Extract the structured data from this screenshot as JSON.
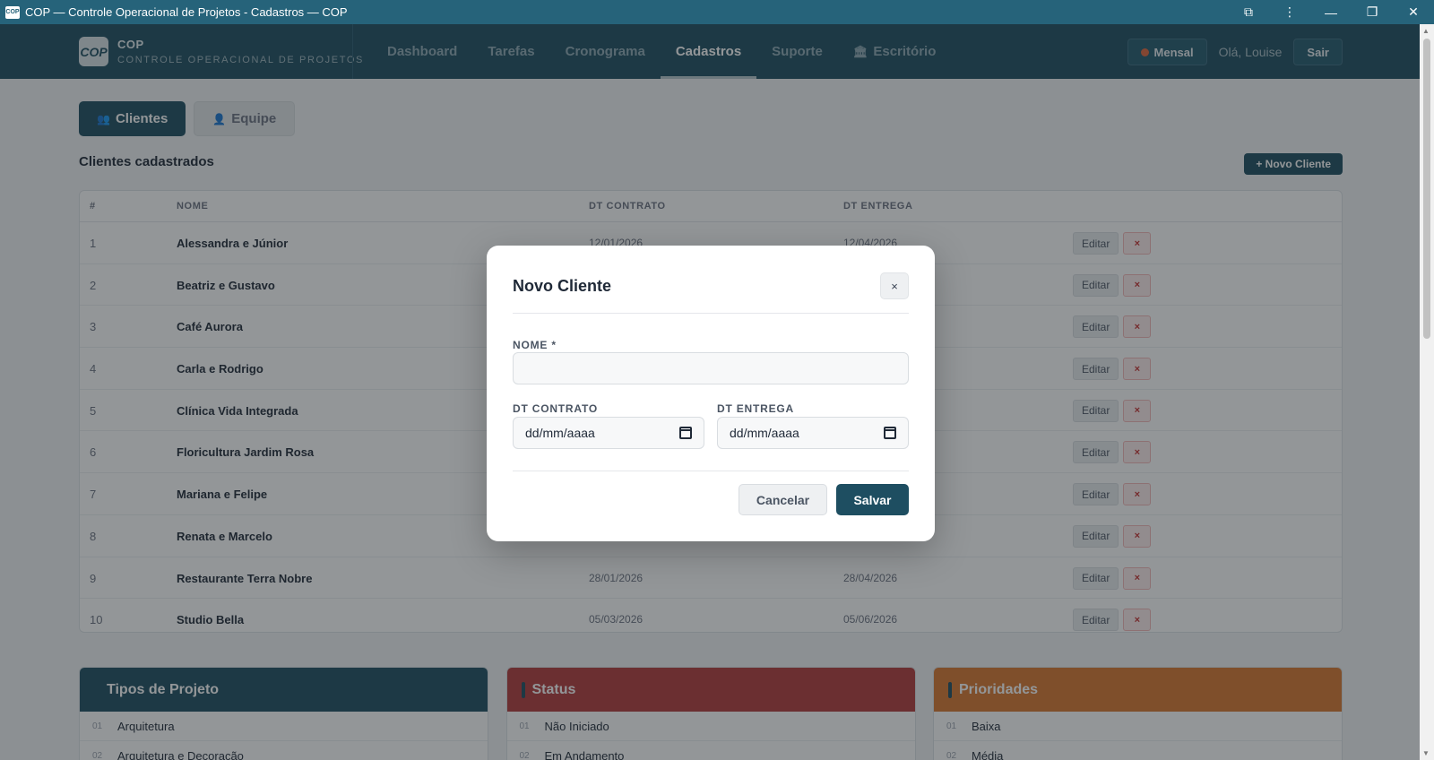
{
  "window": {
    "icon_text": "COP",
    "title": "COP — Controle Operacional de Projetos - Cadastros — COP",
    "controls": {
      "extensions": "⧉",
      "menu": "⋮",
      "minimize": "—",
      "restore": "❐",
      "close": "✕"
    }
  },
  "header": {
    "logo_text": "COP",
    "brand_name": "COP",
    "brand_subtitle": "CONTROLE OPERACIONAL DE PROJETOS",
    "nav": [
      {
        "label": "Dashboard"
      },
      {
        "label": "Tarefas"
      },
      {
        "label": "Cronograma"
      },
      {
        "label": "Cadastros",
        "active": true
      },
      {
        "label": "Suporte"
      },
      {
        "label": "Escritório",
        "icon": "bank-icon"
      }
    ],
    "period_label": "Mensal",
    "greeting": "Olá, Louise",
    "logout_label": "Sair"
  },
  "tabs": [
    {
      "label": "Clientes",
      "icon": "people-icon",
      "active": true
    },
    {
      "label": "Equipe",
      "icon": "person-icon",
      "active": false
    }
  ],
  "clients": {
    "section_title": "Clientes cadastrados",
    "new_button": "+ Novo Cliente",
    "columns": [
      "#",
      "NOME",
      "DT CONTRATO",
      "DT ENTREGA"
    ],
    "edit_label": "Editar",
    "delete_label": "×",
    "rows": [
      {
        "num": "1",
        "name": "Alessandra e Júnior",
        "dt_contrato": "12/01/2026",
        "dt_entrega": "12/04/2026"
      },
      {
        "num": "2",
        "name": "Beatriz e Gustavo",
        "dt_contrato": "",
        "dt_entrega": ""
      },
      {
        "num": "3",
        "name": "Café Aurora",
        "dt_contrato": "",
        "dt_entrega": ""
      },
      {
        "num": "4",
        "name": "Carla e Rodrigo",
        "dt_contrato": "",
        "dt_entrega": ""
      },
      {
        "num": "5",
        "name": "Clínica Vida Integrada",
        "dt_contrato": "",
        "dt_entrega": ""
      },
      {
        "num": "6",
        "name": "Floricultura Jardim Rosa",
        "dt_contrato": "",
        "dt_entrega": ""
      },
      {
        "num": "7",
        "name": "Mariana e Felipe",
        "dt_contrato": "",
        "dt_entrega": ""
      },
      {
        "num": "8",
        "name": "Renata e Marcelo",
        "dt_contrato": "",
        "dt_entrega": ""
      },
      {
        "num": "9",
        "name": "Restaurante Terra Nobre",
        "dt_contrato": "28/01/2026",
        "dt_entrega": "28/04/2026"
      },
      {
        "num": "10",
        "name": "Studio Bella",
        "dt_contrato": "05/03/2026",
        "dt_entrega": "05/06/2026"
      }
    ]
  },
  "cards": [
    {
      "title": "Tipos de Projeto",
      "color": "#1e4e61",
      "items": [
        {
          "idx": "01",
          "label": "Arquitetura"
        },
        {
          "idx": "02",
          "label": "Arquitetura e Decoração"
        }
      ]
    },
    {
      "title": "Status",
      "color": "#b23a3a",
      "items": [
        {
          "idx": "01",
          "label": "Não Iniciado"
        },
        {
          "idx": "02",
          "label": "Em Andamento"
        }
      ]
    },
    {
      "title": "Prioridades",
      "color": "#d9772f",
      "items": [
        {
          "idx": "01",
          "label": "Baixa"
        },
        {
          "idx": "02",
          "label": "Média"
        }
      ]
    }
  ],
  "modal": {
    "title": "Novo Cliente",
    "close_label": "×",
    "name_label": "NOME *",
    "name_value": "",
    "contrato_label": "DT CONTRATO",
    "contrato_placeholder": "dd/mm/aaaa",
    "entrega_label": "DT ENTREGA",
    "entrega_placeholder": "dd/mm/aaaa",
    "cancel_label": "Cancelar",
    "save_label": "Salvar"
  }
}
